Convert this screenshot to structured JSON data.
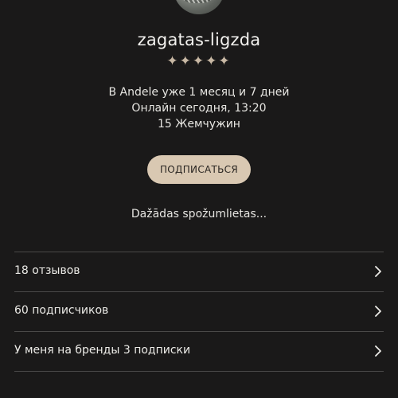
{
  "profile": {
    "username": "zagatas-ligzda",
    "rating_stars": "✦✦✦✦✦",
    "rating": 5,
    "member_since": "В Andele уже 1 месяц и 7 дней",
    "last_online": "Онлайн сегодня, 13:20",
    "pearls": "15 Жемчужин",
    "bio": "Dažādas spožumlietas..."
  },
  "actions": {
    "subscribe_label": "ПОДПИСАТЬСЯ"
  },
  "list": {
    "items": [
      {
        "label": "18 отзывов",
        "icon": "chevron-right-icon"
      },
      {
        "label": "60 подписчиков",
        "icon": "chevron-right-icon"
      },
      {
        "label": "У меня на бренды 3 подписки",
        "icon": "chevron-right-icon"
      }
    ]
  },
  "colors": {
    "background": "#1a1919",
    "text": "#ecebe7",
    "accent_button": "#d9c8b2",
    "stars": "#c8b8a4",
    "divider": "#4a4948"
  }
}
